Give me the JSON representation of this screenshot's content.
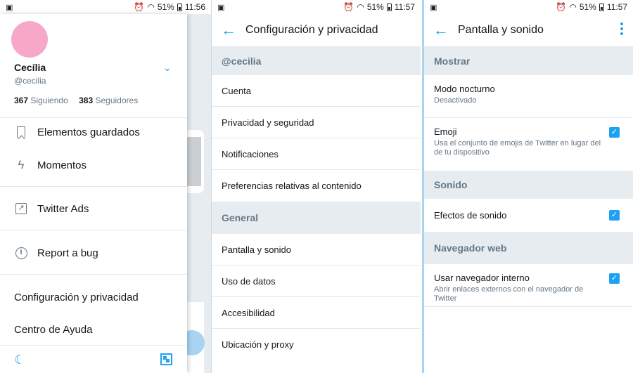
{
  "status": {
    "p1": {
      "battery": "51%",
      "time": "11:56"
    },
    "p2": {
      "battery": "51%",
      "time": "11:57"
    },
    "p3": {
      "battery": "51%",
      "time": "11:57"
    }
  },
  "drawer": {
    "name": "Cecília",
    "handle": "@cecilia",
    "following_count": "367",
    "following_label": "Siguiendo",
    "followers_count": "383",
    "followers_label": "Seguidores",
    "items": [
      {
        "label": "Elementos guardados",
        "icon": "bookmark-icon"
      },
      {
        "label": "Momentos",
        "icon": "lightning-icon"
      },
      {
        "label": "Twitter Ads",
        "icon": "external-link-icon"
      },
      {
        "label": "Report a bug",
        "icon": "info-icon"
      }
    ],
    "settings_label": "Configuración y privacidad",
    "help_label": "Centro de Ayuda",
    "bottom_icons": [
      "moon-icon",
      "qr-code-icon"
    ]
  },
  "settings": {
    "title": "Configuración y privacidad",
    "account_section": "@cecilia",
    "account_items": [
      "Cuenta",
      "Privacidad y seguridad",
      "Notificaciones",
      "Preferencias relativas al contenido"
    ],
    "general_section": "General",
    "general_items": [
      "Pantalla y sonido",
      "Uso de datos",
      "Accesibilidad",
      "Ubicación y proxy"
    ]
  },
  "display": {
    "title": "Pantalla y sonido",
    "show_section": "Mostrar",
    "night_mode": {
      "title": "Modo nocturno",
      "value": "Desactivado"
    },
    "emoji": {
      "title": "Emoji",
      "desc": "Usa el conjunto de emojis de Twitter en lugar del de tu dispositivo",
      "checked": true
    },
    "sound_section": "Sonido",
    "sound_effects": {
      "title": "Efectos de sonido",
      "checked": true
    },
    "browser_section": "Navegador web",
    "inapp_browser": {
      "title": "Usar navegador interno",
      "desc": "Abrir enlaces externos con el navegador de Twitter",
      "checked": true
    }
  },
  "colors": {
    "accent": "#1da1f2",
    "section_bg": "#e6ecf0",
    "avatar": "#f7a8c8"
  }
}
